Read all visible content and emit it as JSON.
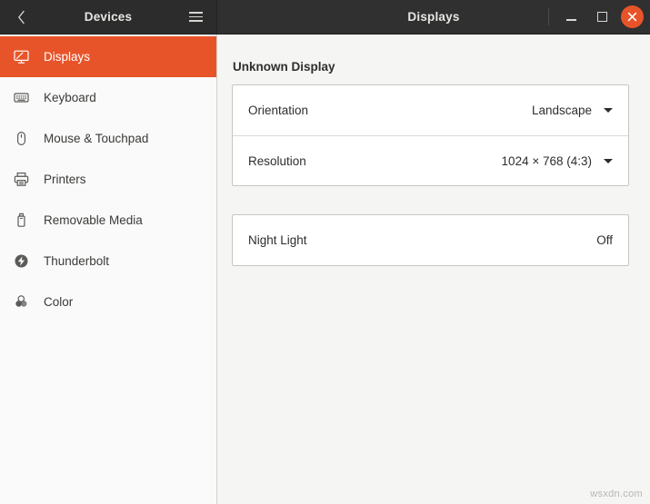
{
  "window": {
    "sidebar_title": "Devices",
    "content_title": "Displays",
    "back_icon": "chevron-left-icon",
    "menu_icon": "hamburger-menu-icon",
    "minimize_label": "Minimize",
    "maximize_label": "Maximize",
    "close_label": "Close",
    "close_button_color": "#e8542a"
  },
  "sidebar": {
    "accent_color": "#e8542a",
    "items": [
      {
        "label": "Displays",
        "icon": "display-icon",
        "name": "displays",
        "selected": true
      },
      {
        "label": "Keyboard",
        "icon": "keyboard-icon",
        "name": "keyboard",
        "selected": false
      },
      {
        "label": "Mouse & Touchpad",
        "icon": "mouse-icon",
        "name": "mouse-touchpad",
        "selected": false
      },
      {
        "label": "Printers",
        "icon": "printer-icon",
        "name": "printers",
        "selected": false
      },
      {
        "label": "Removable Media",
        "icon": "usb-drive-icon",
        "name": "removable-media",
        "selected": false
      },
      {
        "label": "Thunderbolt",
        "icon": "thunderbolt-icon",
        "name": "thunderbolt",
        "selected": false
      },
      {
        "label": "Color",
        "icon": "color-circles-icon",
        "name": "color",
        "selected": false
      }
    ]
  },
  "main": {
    "section_title": "Unknown Display",
    "display_card": {
      "rows": [
        {
          "label": "Orientation",
          "value": "Landscape",
          "name": "orientation",
          "has_dropdown": true
        },
        {
          "label": "Resolution",
          "value": "1024 × 768 (4:3)",
          "name": "resolution",
          "has_dropdown": true
        }
      ]
    },
    "night_light_card": {
      "rows": [
        {
          "label": "Night Light",
          "value": "Off",
          "name": "night-light",
          "has_dropdown": false
        }
      ]
    }
  },
  "watermark": "wsxdn.com"
}
